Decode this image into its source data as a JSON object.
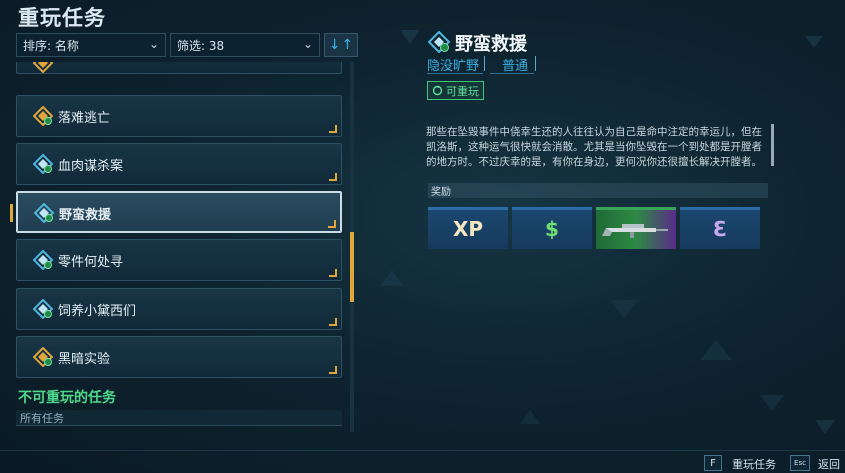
{
  "header": {
    "title": "重玩任务",
    "sort_label": "排序: 名称",
    "filter_label": "筛选: 38"
  },
  "missions": [
    {
      "name": "落难逃亡",
      "icon": "side-mission-icon-orange",
      "selected": false
    },
    {
      "name": "血肉谋杀案",
      "icon": "side-mission-icon-blue",
      "selected": false
    },
    {
      "name": "野蛮救援",
      "icon": "side-mission-icon-blue",
      "selected": true
    },
    {
      "name": "零件何处寻",
      "icon": "side-mission-icon-blue",
      "selected": false
    },
    {
      "name": "饲养小黛西们",
      "icon": "side-mission-icon-blue",
      "selected": false
    },
    {
      "name": "黑暗实验",
      "icon": "side-mission-icon-orange",
      "selected": false
    }
  ],
  "non_replayable": {
    "title": "不可重玩的任务",
    "filter": "所有任务"
  },
  "detail": {
    "title": "野蛮救援",
    "location": "隐没旷野",
    "difficulty": "普通",
    "replay_badge": "可重玩",
    "description": "那些在坠毁事件中侥幸生还的人往往认为自己是命中注定的幸运儿，但在凯洛斯，这种运气很快就会消散。尤其是当你坠毁在一个到处都是开膛者的地方时。不过庆幸的是，有你在身边，更何况你还很擅长解决开膛者。",
    "rewards_label": "奖励",
    "rewards": [
      {
        "type": "xp",
        "symbol": "XP"
      },
      {
        "type": "cash",
        "symbol": "$"
      },
      {
        "type": "weapon",
        "symbol": "weapon-rifle-icon"
      },
      {
        "type": "eridium",
        "symbol": "Ɛ"
      }
    ]
  },
  "footer": {
    "replay_key": "F",
    "replay_label": "重玩任务",
    "back_key": "Esc",
    "back_label": "返回"
  },
  "colors": {
    "accent_orange": "#e0a63a",
    "accent_blue": "#3aaee0",
    "accent_green": "#4fd98a"
  }
}
